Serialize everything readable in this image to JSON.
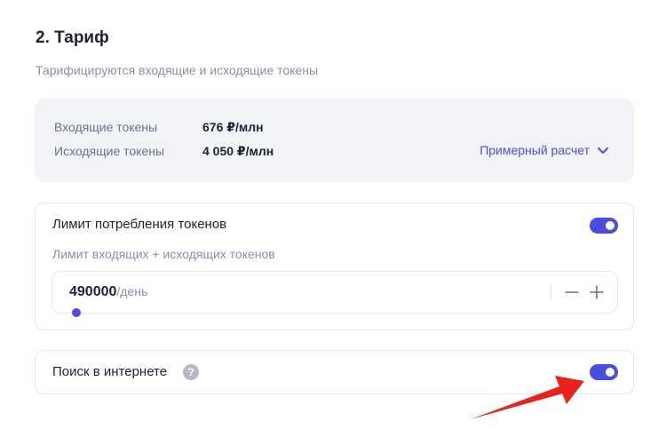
{
  "section": {
    "title": "2. Тариф",
    "subtitle": "Тарифицируются входящие и исходящие токены"
  },
  "pricing": {
    "rows": [
      {
        "label": "Входящие токены",
        "value": "676 ₽/млн"
      },
      {
        "label": "Исходящие токены",
        "value": "4 050 ₽/млн"
      }
    ],
    "estimate_label": "Примерный расчет",
    "estimate_icon": "chevron-down-icon"
  },
  "token_limit": {
    "title": "Лимит потребления токенов",
    "enabled": true,
    "subtitle": "Лимит входящих + исходящих токенов",
    "value": "490000",
    "unit": "/день",
    "slider_position": 0.0
  },
  "web_search": {
    "title": "Поиск в интернете",
    "help_glyph": "?",
    "enabled": true
  },
  "colors": {
    "accent": "#4a4de0",
    "annotation_arrow": "#e8231c",
    "card_background": "#f2f3f7",
    "muted_text": "#8a8fa3"
  }
}
